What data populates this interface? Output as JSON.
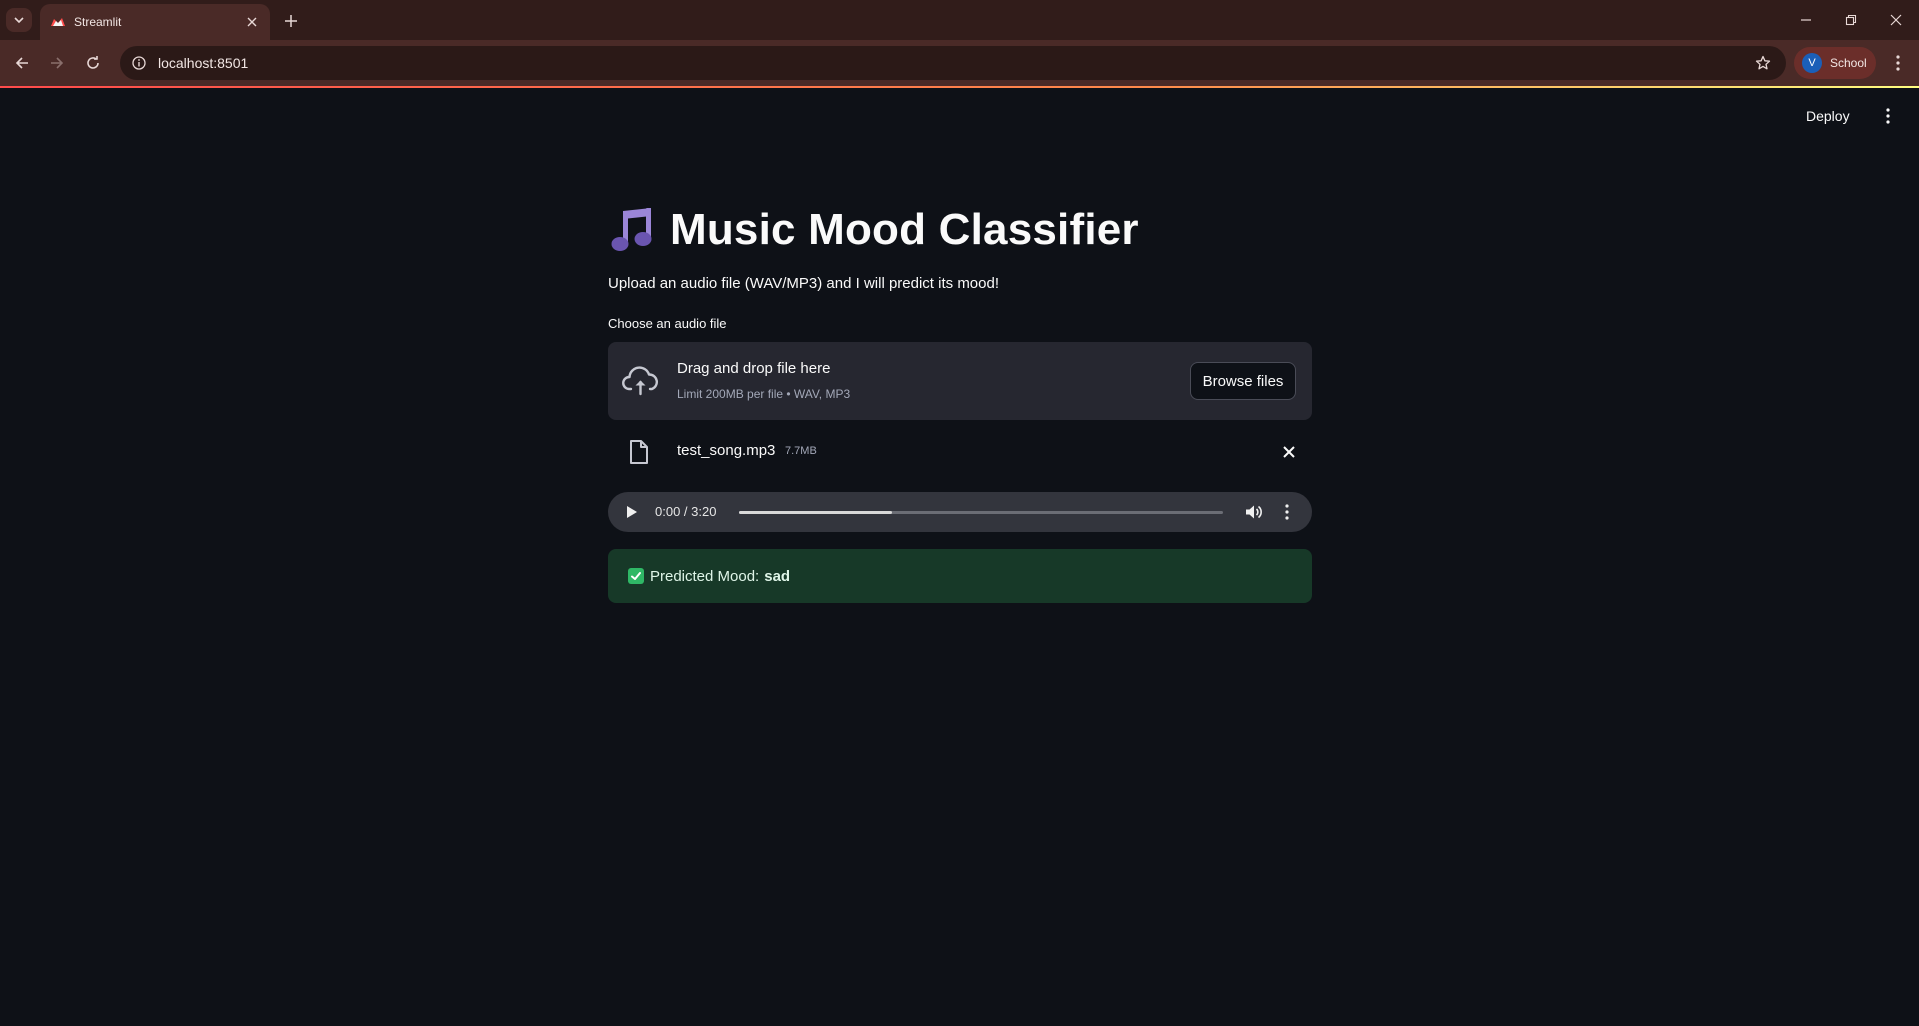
{
  "browser": {
    "tab_title": "Streamlit",
    "url": "localhost:8501",
    "profile_initial": "V",
    "profile_name": "School"
  },
  "app_header": {
    "deploy_label": "Deploy"
  },
  "main": {
    "title": "Music Mood Classifier",
    "title_emoji": "music-notes-icon",
    "subtitle": "Upload an audio file (WAV/MP3) and I will predict its mood!",
    "uploader": {
      "label": "Choose an audio file",
      "drop_title": "Drag and drop file here",
      "limit_text": "Limit 200MB per file • WAV, MP3",
      "browse_label": "Browse files"
    },
    "uploaded_file": {
      "name": "test_song.mp3",
      "size": "7.7MB"
    },
    "audio_player": {
      "time": "0:00 / 3:20",
      "buffered_fraction": 0.316
    },
    "result": {
      "label": "Predicted Mood:",
      "mood": "sad",
      "status_color": "#2fb866"
    }
  }
}
